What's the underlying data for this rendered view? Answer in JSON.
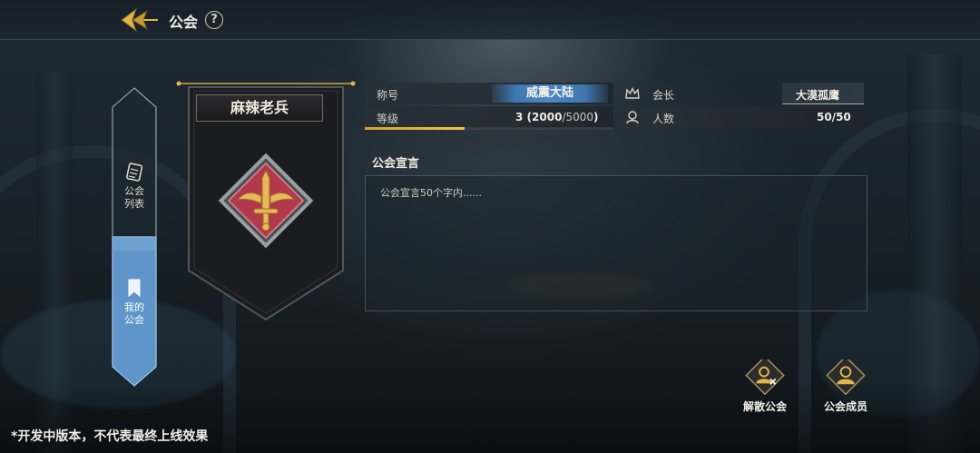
{
  "header": {
    "title": "公会",
    "help_symbol": "?"
  },
  "side_tabs": [
    {
      "label": "公会列表",
      "icon": "scroll-icon",
      "active": false
    },
    {
      "label": "我的公会",
      "icon": "bookmark-icon",
      "active": true
    }
  ],
  "guild": {
    "name": "麻辣老兵",
    "emblem": "winged-sword-icon",
    "fields": {
      "title_label": "称号",
      "title_value": "威震大陆",
      "level_label": "等级",
      "level_value": "3",
      "exp_current": "2000",
      "exp_max": "5000",
      "exp_progress": 0.4,
      "leader_label": "会长",
      "leader_value": "大漠孤鹰",
      "members_label": "人数",
      "members_value": "50/50"
    },
    "declaration": {
      "label": "公会宣言",
      "placeholder": "公会宣言50个字内......"
    }
  },
  "actions": {
    "disband_label": "解散公会",
    "members_label": "公会成员"
  },
  "footnote": "*开发中版本，不代表最终上线效果",
  "colors": {
    "accent_gold": "#e0b64a",
    "tab_active": "#5f95c8",
    "title_badge": "#4b86c2"
  }
}
